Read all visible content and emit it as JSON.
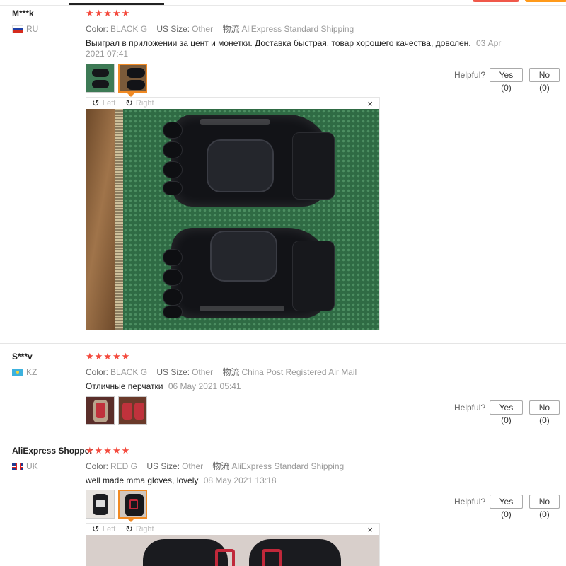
{
  "reviews": [
    {
      "user": "M***k",
      "country": "RU",
      "stars": "★★★★★",
      "color_label": "Color:",
      "color_value": "BLACK G",
      "size_label": "US Size:",
      "size_value": "Other",
      "shipping_label": "物流",
      "shipping_value": "AliExpress Standard Shipping",
      "text": "Выиграл в приложении за цент и монетки. Доставка быстрая, товар хорошего качества, доволен.",
      "date": "03 Apr 2021 07:41"
    },
    {
      "user": "S***v",
      "country": "KZ",
      "stars": "★★★★★",
      "color_label": "Color:",
      "color_value": "BLACK G",
      "size_label": "US Size:",
      "size_value": "Other",
      "shipping_label": "物流",
      "shipping_value": "China Post Registered Air Mail",
      "text": "Отличные перчатки",
      "date": "06 May 2021 05:41"
    },
    {
      "user": "AliExpress Shopper",
      "country": "UK",
      "stars": "★★★★★",
      "color_label": "Color:",
      "color_value": "RED G",
      "size_label": "US Size:",
      "size_value": "Other",
      "shipping_label": "物流",
      "shipping_value": "AliExpress Standard Shipping",
      "text": "well made mma gloves, lovely",
      "date": "08 May 2021 13:18"
    }
  ],
  "helpful": {
    "label": "Helpful?",
    "yes": "Yes (0)",
    "no": "No (0)"
  },
  "viewer": {
    "left": "Left",
    "right": "Right",
    "close": "×",
    "rotate_left_icon": "↺",
    "rotate_right_icon": "↻"
  },
  "colors": {
    "star": "#f44a3d",
    "selected_thumb": "#f08a24",
    "top_red": "#f0584a",
    "top_orange": "#ff9a1a"
  }
}
